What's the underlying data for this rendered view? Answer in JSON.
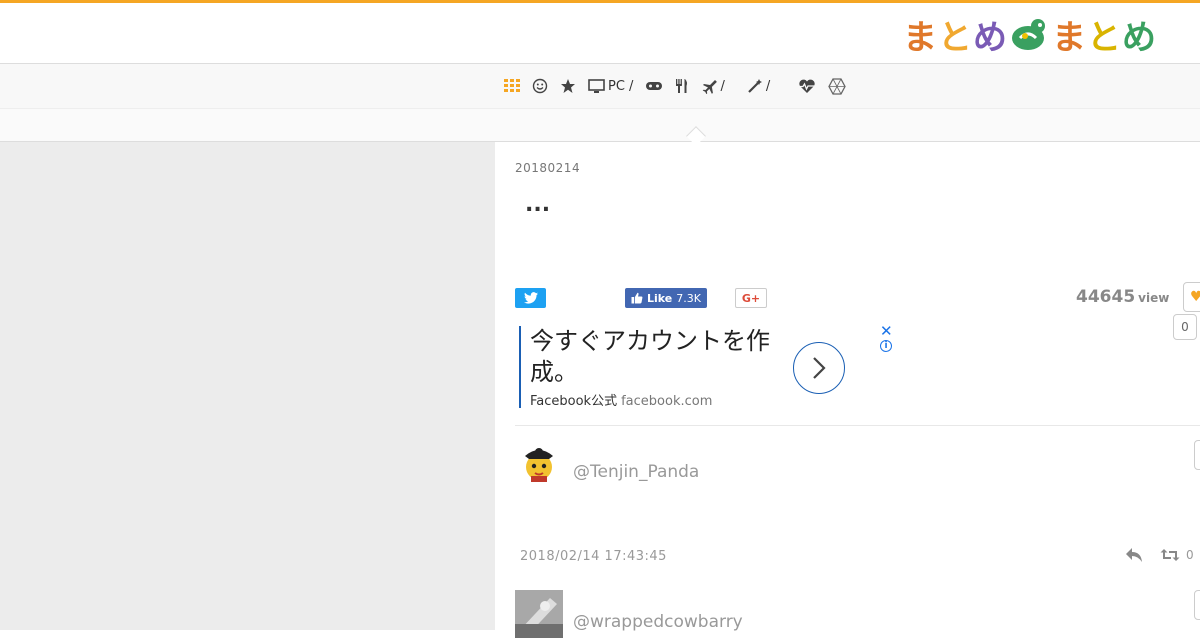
{
  "header": {
    "logo_text": "まとめまとめ",
    "logo_chars": [
      "ま",
      "と",
      "め",
      "ま",
      "と",
      "め"
    ],
    "accent_color": "#f5a623"
  },
  "category_nav": {
    "items": [
      {
        "icon": "grid-icon",
        "label": ""
      },
      {
        "icon": "smiley-icon",
        "label": ""
      },
      {
        "icon": "star-icon",
        "label": ""
      },
      {
        "icon": "monitor-icon",
        "label": "PC /"
      },
      {
        "icon": "gamepad-icon",
        "label": ""
      },
      {
        "icon": "fork-knife-icon",
        "label": ""
      },
      {
        "icon": "airplane-icon",
        "label": "/"
      },
      {
        "icon": "magic-wand-icon",
        "label": "/"
      },
      {
        "icon": "heartbeat-icon",
        "label": ""
      },
      {
        "icon": "hexagon-icon",
        "label": ""
      }
    ]
  },
  "article": {
    "date": "20180214",
    "title": "...",
    "views_count": "44645",
    "views_label": "view",
    "favorite_count": "0"
  },
  "share": {
    "facebook_label": "Like",
    "facebook_count": "7.3K",
    "google_label": "G+"
  },
  "ad": {
    "headline": "今すぐアカウントを作成。",
    "source": "Facebook公式",
    "domain": "facebook.com",
    "close_glyph": "✕",
    "info_glyph": "i"
  },
  "tweets": [
    {
      "handle": "@Tenjin_Panda",
      "date": "2018/02/14 17:43:45",
      "retweets": "0"
    },
    {
      "handle": "@wrappedcowbarry"
    }
  ]
}
